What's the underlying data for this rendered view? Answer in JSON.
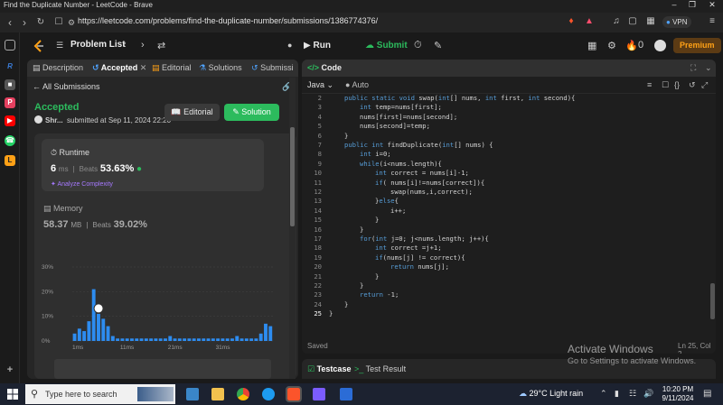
{
  "browser": {
    "tab_title": "Find the Duplicate Number - LeetCode - Brave",
    "url": "https://leetcode.com/problems/find-the-duplicate-number/submissions/1386774376/",
    "vpn_label": "VPN"
  },
  "header": {
    "problem_list": "Problem List",
    "run_label": "Run",
    "submit_label": "Submit",
    "streak": "0",
    "premium_label": "Premium"
  },
  "left_tabs": [
    {
      "label": "Description"
    },
    {
      "label": "Accepted"
    },
    {
      "label": "Editorial"
    },
    {
      "label": "Solutions"
    },
    {
      "label": "Submissi"
    }
  ],
  "submission": {
    "back_label": "All Submissions",
    "status": "Accepted",
    "user": "Shr...",
    "submitted_at": "submitted at Sep 11, 2024 22:20",
    "editorial_btn": "Editorial",
    "solution_btn": "Solution",
    "runtime_label": "Runtime",
    "runtime_value": "6",
    "runtime_unit": "ms",
    "beats_label": "Beats",
    "runtime_beats": "53.63%",
    "analyze_label": "Analyze Complexity",
    "memory_label": "Memory",
    "memory_value": "58.37",
    "memory_unit": "MB",
    "memory_beats": "39.02%"
  },
  "chart_data": {
    "type": "bar",
    "y_ticks": [
      "30%",
      "20%",
      "10%",
      "0%"
    ],
    "ylim": [
      0,
      30
    ],
    "x_ticks": [
      "1ms",
      "11ms",
      "21ms",
      "31ms"
    ],
    "highlight_index": 5,
    "values": [
      3,
      5,
      4,
      8,
      21,
      11,
      9,
      6,
      2,
      1,
      1,
      1,
      1,
      1,
      1,
      1,
      1,
      1,
      1,
      1,
      2,
      1,
      1,
      1,
      1,
      1,
      1,
      1,
      1,
      1,
      1,
      1,
      1,
      1,
      2,
      1,
      1,
      1,
      1,
      3,
      7,
      6
    ],
    "bar_color": "#2d8cf0",
    "highlight_color": "#ffffff"
  },
  "code": {
    "title": "Code",
    "language": "Java",
    "mode": "Auto",
    "saved": "Saved",
    "cursor": "Ln 25, Col 2",
    "current_line": 25,
    "lines": [
      {
        "n": "2",
        "indent": 1,
        "text": "public static void swap(int[] nums, int first, int second){"
      },
      {
        "n": "3",
        "indent": 2,
        "text": "int temp=nums[first];"
      },
      {
        "n": "4",
        "indent": 2,
        "text": "nums[first]=nums[second];"
      },
      {
        "n": "5",
        "indent": 2,
        "text": "nums[second]=temp;"
      },
      {
        "n": "6",
        "indent": 1,
        "text": "}"
      },
      {
        "n": "7",
        "indent": 1,
        "text": "public int findDuplicate(int[] nums) {"
      },
      {
        "n": "8",
        "indent": 2,
        "text": "int i=0;"
      },
      {
        "n": "9",
        "indent": 2,
        "text": "while(i<nums.length){"
      },
      {
        "n": "10",
        "indent": 3,
        "text": "int correct = nums[i]-1;"
      },
      {
        "n": "11",
        "indent": 3,
        "text": "if( nums[i]!=nums[correct]){"
      },
      {
        "n": "12",
        "indent": 4,
        "text": "swap(nums,i,correct);"
      },
      {
        "n": "13",
        "indent": 3,
        "text": "}else{"
      },
      {
        "n": "14",
        "indent": 4,
        "text": "i++;"
      },
      {
        "n": "15",
        "indent": 3,
        "text": "}"
      },
      {
        "n": "16",
        "indent": 2,
        "text": "}"
      },
      {
        "n": "17",
        "indent": 2,
        "text": "for(int j=0; j<nums.length; j++){"
      },
      {
        "n": "18",
        "indent": 3,
        "text": "int correct =j+1;"
      },
      {
        "n": "19",
        "indent": 3,
        "text": "if(nums[j] != correct){"
      },
      {
        "n": "20",
        "indent": 4,
        "text": "return nums[j];"
      },
      {
        "n": "21",
        "indent": 3,
        "text": "}"
      },
      {
        "n": "22",
        "indent": 2,
        "text": "}"
      },
      {
        "n": "23",
        "indent": 2,
        "text": "return -1;"
      },
      {
        "n": "24",
        "indent": 1,
        "text": "}"
      },
      {
        "n": "25",
        "indent": 0,
        "text": "}"
      }
    ]
  },
  "bottom": {
    "testcase_label": "Testcase",
    "testresult_label": "Test Result"
  },
  "watermark": {
    "line1": "Activate Windows",
    "line2": "Go to Settings to activate Windows."
  },
  "taskbar": {
    "search_placeholder": "Type here to search",
    "weather": "29°C  Light rain",
    "time": "10:20 PM",
    "date": "9/11/2024"
  }
}
